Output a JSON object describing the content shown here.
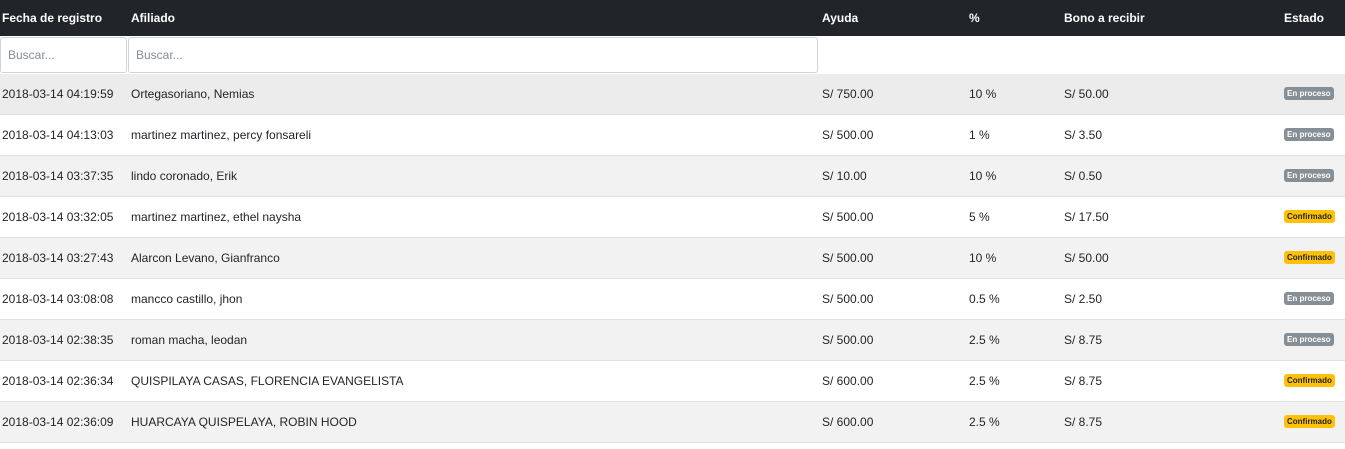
{
  "table": {
    "headers": {
      "fecha": "Fecha de registro",
      "afiliado": "Afiliado",
      "ayuda": "Ayuda",
      "pct": "%",
      "bono": "Bono a recibir",
      "estado": "Estado"
    },
    "filters": {
      "fecha_placeholder": "Buscar...",
      "afiliado_placeholder": "Buscar..."
    },
    "rows": [
      {
        "fecha": "2018-03-14 04:19:59",
        "afiliado": "Ortegasoriano, Nemias",
        "ayuda": "S/ 750.00",
        "pct": "10 %",
        "bono": "S/ 50.00",
        "estado": "En proceso",
        "estado_type": "proceso"
      },
      {
        "fecha": "2018-03-14 04:13:03",
        "afiliado": "martinez martinez, percy fonsareli",
        "ayuda": "S/ 500.00",
        "pct": "1 %",
        "bono": "S/ 3.50",
        "estado": "En proceso",
        "estado_type": "proceso"
      },
      {
        "fecha": "2018-03-14 03:37:35",
        "afiliado": "lindo coronado, Erik",
        "ayuda": "S/ 10.00",
        "pct": "10 %",
        "bono": "S/ 0.50",
        "estado": "En proceso",
        "estado_type": "proceso"
      },
      {
        "fecha": "2018-03-14 03:32:05",
        "afiliado": "martinez martinez, ethel naysha",
        "ayuda": "S/ 500.00",
        "pct": "5 %",
        "bono": "S/ 17.50",
        "estado": "Confirmado",
        "estado_type": "confirmado"
      },
      {
        "fecha": "2018-03-14 03:27:43",
        "afiliado": "Alarcon Levano, Gianfranco",
        "ayuda": "S/ 500.00",
        "pct": "10 %",
        "bono": "S/ 50.00",
        "estado": "Confirmado",
        "estado_type": "confirmado"
      },
      {
        "fecha": "2018-03-14 03:08:08",
        "afiliado": "mancco castillo, jhon",
        "ayuda": "S/ 500.00",
        "pct": "0.5 %",
        "bono": "S/ 2.50",
        "estado": "En proceso",
        "estado_type": "proceso"
      },
      {
        "fecha": "2018-03-14 02:38:35",
        "afiliado": "roman macha, leodan",
        "ayuda": "S/ 500.00",
        "pct": "2.5 %",
        "bono": "S/ 8.75",
        "estado": "En proceso",
        "estado_type": "proceso"
      },
      {
        "fecha": "2018-03-14 02:36:34",
        "afiliado": "QUISPILAYA CASAS, FLORENCIA EVANGELISTA",
        "ayuda": "S/ 600.00",
        "pct": "2.5 %",
        "bono": "S/ 8.75",
        "estado": "Confirmado",
        "estado_type": "confirmado"
      },
      {
        "fecha": "2018-03-14 02:36:09",
        "afiliado": "HUARCAYA QUISPELAYA, ROBIN HOOD",
        "ayuda": "S/ 600.00",
        "pct": "2.5 %",
        "bono": "S/ 8.75",
        "estado": "Confirmado",
        "estado_type": "confirmado"
      }
    ],
    "colors": {
      "header_bg": "#212529",
      "badge_proceso": "#868e96",
      "badge_confirmado": "#ffc107"
    }
  }
}
